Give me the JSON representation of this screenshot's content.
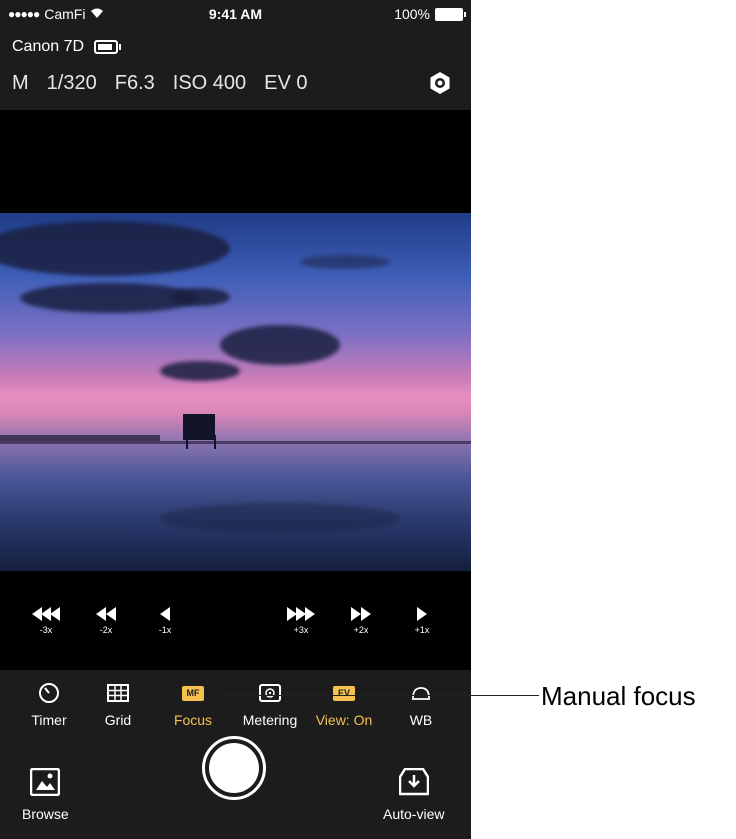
{
  "status_bar": {
    "carrier": "CamFi",
    "time": "9:41 AM",
    "battery": "100%"
  },
  "camera": {
    "name": "Canon 7D",
    "mode": "M",
    "shutter": "1/320",
    "aperture": "F6.3",
    "iso": "ISO 400",
    "ev": "EV 0"
  },
  "focus_steps": [
    {
      "label": "-3x",
      "icon": "triple-left-arrow"
    },
    {
      "label": "-2x",
      "icon": "double-left-arrow"
    },
    {
      "label": "-1x",
      "icon": "single-left-arrow"
    },
    {
      "label": "+3x",
      "icon": "triple-right-arrow"
    },
    {
      "label": "+2x",
      "icon": "double-right-arrow"
    },
    {
      "label": "+1x",
      "icon": "single-right-arrow"
    }
  ],
  "toolbar": {
    "timer": "Timer",
    "grid": "Grid",
    "focus": "Focus",
    "focus_badge": "MF",
    "metering": "Metering",
    "view": "View: On",
    "view_badge": "EV",
    "wb": "WB"
  },
  "bottom": {
    "browse": "Browse",
    "auto_view": "Auto-view"
  },
  "annotation": {
    "text": "Manual focus"
  },
  "colors": {
    "accent": "#f5c252",
    "bar": "#1c1c1c"
  }
}
